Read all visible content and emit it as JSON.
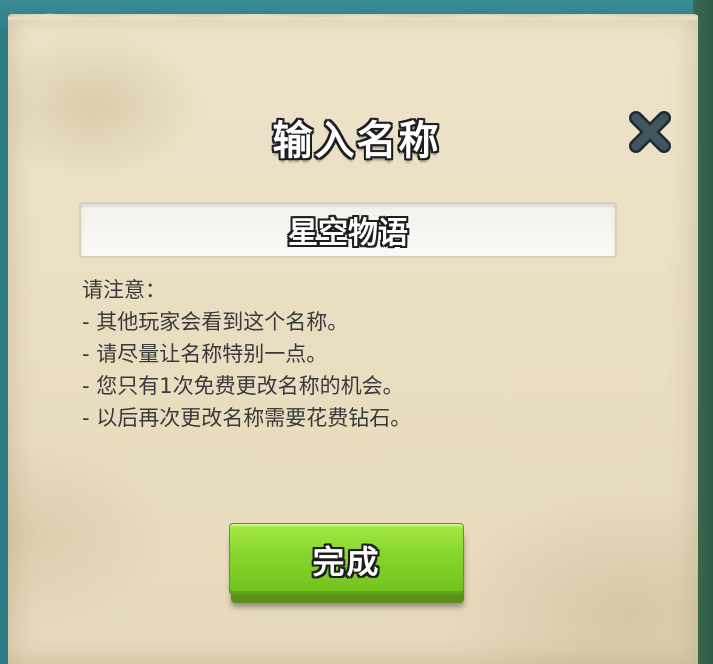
{
  "dialog": {
    "title": "输入名称",
    "close_icon": "close-x-icon",
    "name_input": {
      "value": "星空物语"
    },
    "notice": {
      "heading": "请注意：",
      "items": [
        "- 其他玩家会看到这个名称。",
        "- 请尽量让名称特别一点。",
        "- 您只有1次免费更改名称的机会。",
        "- 以后再次更改名称需要花费钻石。"
      ]
    },
    "done_button": {
      "label": "完成"
    }
  },
  "colors": {
    "panel": "#ece1c6",
    "button_green": "#86d52b",
    "text": "#3a3a3a",
    "background_teal": "#2f7b86"
  }
}
